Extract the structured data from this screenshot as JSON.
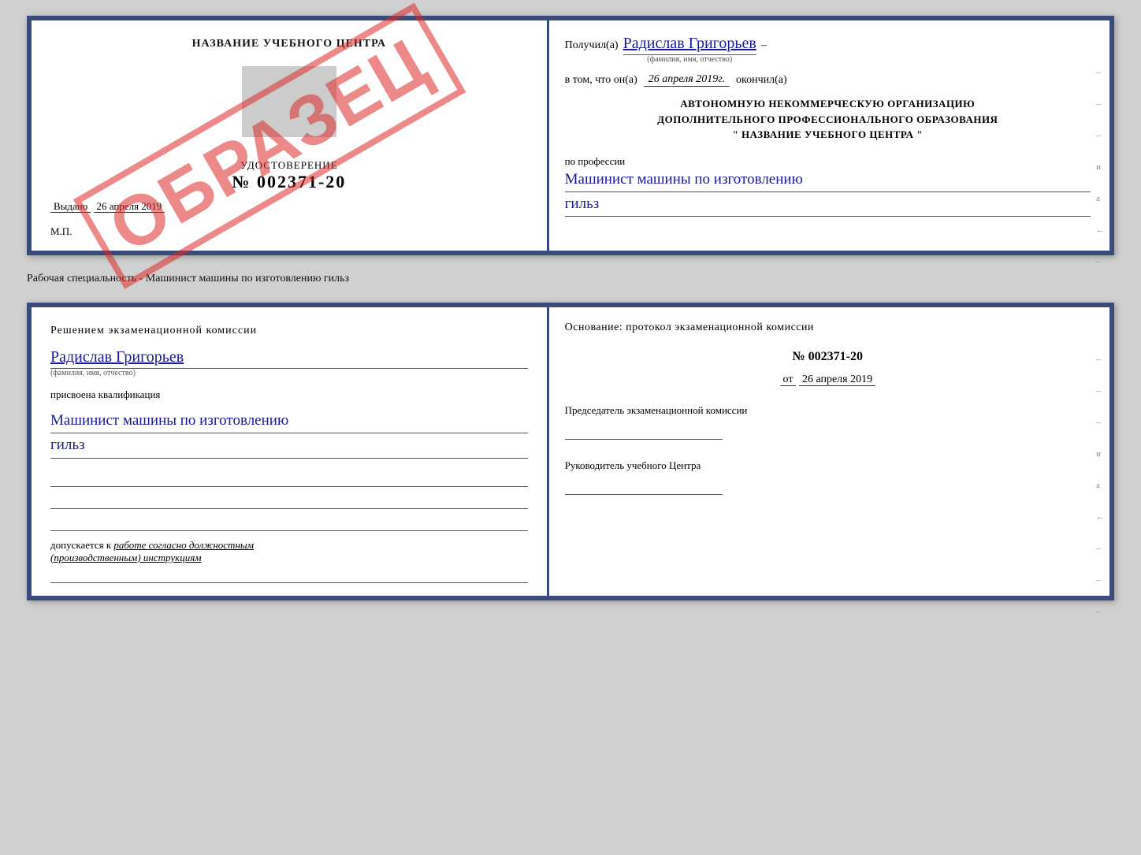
{
  "top_doc": {
    "left": {
      "center_title": "НАЗВАНИЕ УЧЕБНОГО ЦЕНТРА",
      "watermark": "ОБРАЗЕЦ",
      "id_label": "УДОСТОВЕРЕНИЕ",
      "id_number": "№ 002371-20",
      "issued_label": "Выдано",
      "issued_date": "26 апреля 2019",
      "mp_label": "М.П."
    },
    "right": {
      "received_prefix": "Получил(а)",
      "received_name": "Радислав Григорьев",
      "received_sublabel": "(фамилия, имя, отчество)",
      "dash": "–",
      "completed_prefix": "в том, что он(а)",
      "completed_date": "26 апреля 2019г.",
      "completed_suffix": "окончил(а)",
      "org_line1": "АВТОНОМНУЮ НЕКОММЕРЧЕСКУЮ ОРГАНИЗАЦИЮ",
      "org_line2": "ДОПОЛНИТЕЛЬНОГО ПРОФЕССИОНАЛЬНОГО ОБРАЗОВАНИЯ",
      "org_line3": "\" НАЗВАНИЕ УЧЕБНОГО ЦЕНТРА \"",
      "profession_label": "по профессии",
      "profession_name": "Машинист машины по изготовлению",
      "profession_name2": "гильз",
      "right_marks": [
        "–",
        "–",
        "–",
        "и",
        "а",
        "←",
        "–"
      ]
    }
  },
  "separator": {
    "text": "Рабочая специальность - Машинист машины по изготовлению гильз"
  },
  "bottom_doc": {
    "left": {
      "decision_title": "Решением  экзаменационной  комиссии",
      "decision_name": "Радислав Григорьев",
      "decision_sublabel": "(фамилия, имя, отчество)",
      "qualification_label": "присвоена квалификация",
      "qualification_name": "Машинист машины по изготовлению",
      "qualification_name2": "гильз",
      "допускается_label": "допускается к",
      "допускается_text": "работе согласно должностным",
      "допускается_text2": "(производственным) инструкциям"
    },
    "right": {
      "basis_title": "Основание: протокол экзаменационной  комиссии",
      "protocol_number": "№ 002371-20",
      "date_prefix": "от",
      "protocol_date": "26 апреля 2019",
      "chairman_label": "Председатель экзаменационной комиссии",
      "head_label": "Руководитель учебного Центра",
      "right_marks": [
        "–",
        "–",
        "–",
        "и",
        "а",
        "←",
        "–",
        "–",
        "–"
      ]
    }
  }
}
